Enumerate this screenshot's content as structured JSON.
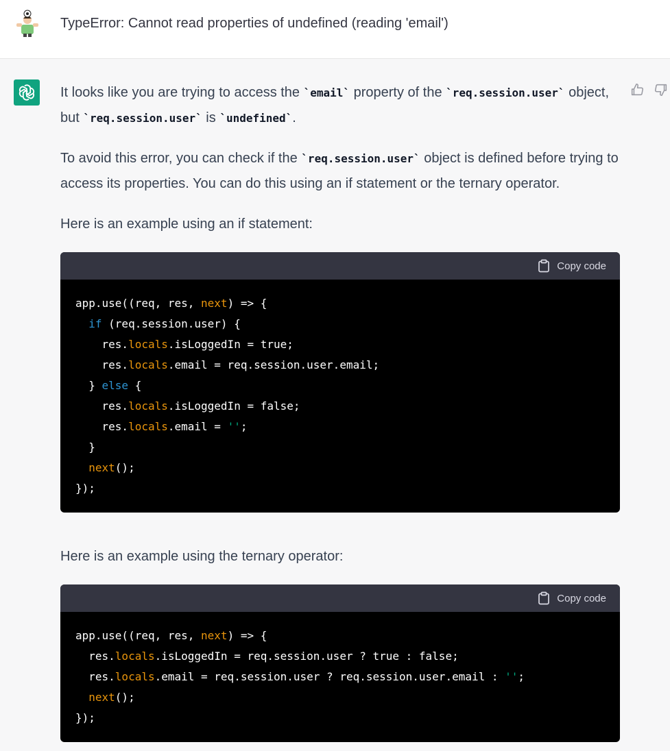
{
  "user": {
    "message": "TypeError: Cannot read properties of undefined (reading 'email')"
  },
  "assistant": {
    "p1": {
      "t1": "It looks like you are trying to access the ",
      "c1": "`email`",
      "t2": " property of the ",
      "c2": "`req.session.user`",
      "t3": " object, but ",
      "c3": "`req.session.user`",
      "t4": " is ",
      "c4": "`undefined`",
      "t5": "."
    },
    "p2": {
      "t1": "To avoid this error, you can check if the ",
      "c1": "`req.session.user`",
      "t2": " object is defined before trying to access its properties. You can do this using an if statement or the ternary operator."
    },
    "p3": "Here is an example using an if statement:",
    "p4": "Here is an example using the ternary operator:",
    "copy_label": "Copy code",
    "icons": {
      "avatar_bot": "openai-logo-icon",
      "thumbs_up": "thumbs-up-icon",
      "thumbs_down": "thumbs-down-icon",
      "clipboard": "clipboard-icon"
    }
  },
  "code1": {
    "l1a": "app.use((req, res, ",
    "l1b": "next",
    "l1c": ") => {",
    "l2a": "  ",
    "l2b": "if",
    "l2c": " (req.session.user) {",
    "l3a": "    res.",
    "l3b": "locals",
    "l3c": ".isLoggedIn = true;",
    "l4a": "    res.",
    "l4b": "locals",
    "l4c": ".email = req.session.user.email;",
    "l5a": "  } ",
    "l5b": "else",
    "l5c": " {",
    "l6a": "    res.",
    "l6b": "locals",
    "l6c": ".isLoggedIn = false;",
    "l7a": "    res.",
    "l7b": "locals",
    "l7c": ".email = ",
    "l7d": "''",
    "l7e": ";",
    "l8": "  }",
    "l9a": "  ",
    "l9b": "next",
    "l9c": "();",
    "l10": "});"
  },
  "code2": {
    "l1a": "app.use((req, res, ",
    "l1b": "next",
    "l1c": ") => {",
    "l2a": "  res.",
    "l2b": "locals",
    "l2c": ".isLoggedIn = req.session.user ? true : false;",
    "l3a": "  res.",
    "l3b": "locals",
    "l3c": ".email = req.session.user ? req.session.user.email : ",
    "l3d": "''",
    "l3e": ";",
    "l4a": "  ",
    "l4b": "next",
    "l4c": "();",
    "l5": "});"
  },
  "colors": {
    "bot_avatar": "#10a37f",
    "code_bg": "#000000",
    "code_header": "#343541",
    "keyword": "#2e95d3",
    "local": "#e9950c",
    "string": "#00a67d"
  }
}
